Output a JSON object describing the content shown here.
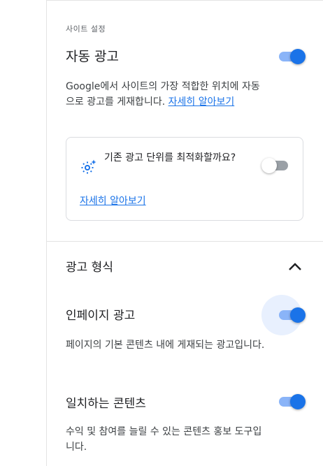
{
  "site_settings": {
    "eyebrow": "사이트 설정",
    "auto_ads": {
      "title": "자동 광고",
      "enabled": true,
      "description": "Google에서 사이트의 가장 적합한 위치에 자동으로 광고를 게재합니다. ",
      "learn_more": "자세히 알아보기"
    },
    "optimize_card": {
      "text": "기존 광고 단위를 최적화할까요?",
      "enabled": false,
      "icon": "gear-sparkle-icon",
      "learn_more": "자세히 알아보기"
    }
  },
  "ad_formats": {
    "title": "광고 형식",
    "expanded": true,
    "items": [
      {
        "title": "인페이지 광고",
        "enabled": true,
        "description": "페이지의 기본 콘텐츠 내에 게재되는 광고입니다."
      },
      {
        "title": "일치하는 콘텐츠",
        "enabled": true,
        "description": "수익 및 참여를 늘릴 수 있는 콘텐츠 홍보 도구입니다."
      }
    ]
  },
  "colors": {
    "accent": "#1a73e8",
    "track_on": "#8ab4f8",
    "track_off": "#9aa0a6",
    "divider": "#e3e3e3"
  }
}
